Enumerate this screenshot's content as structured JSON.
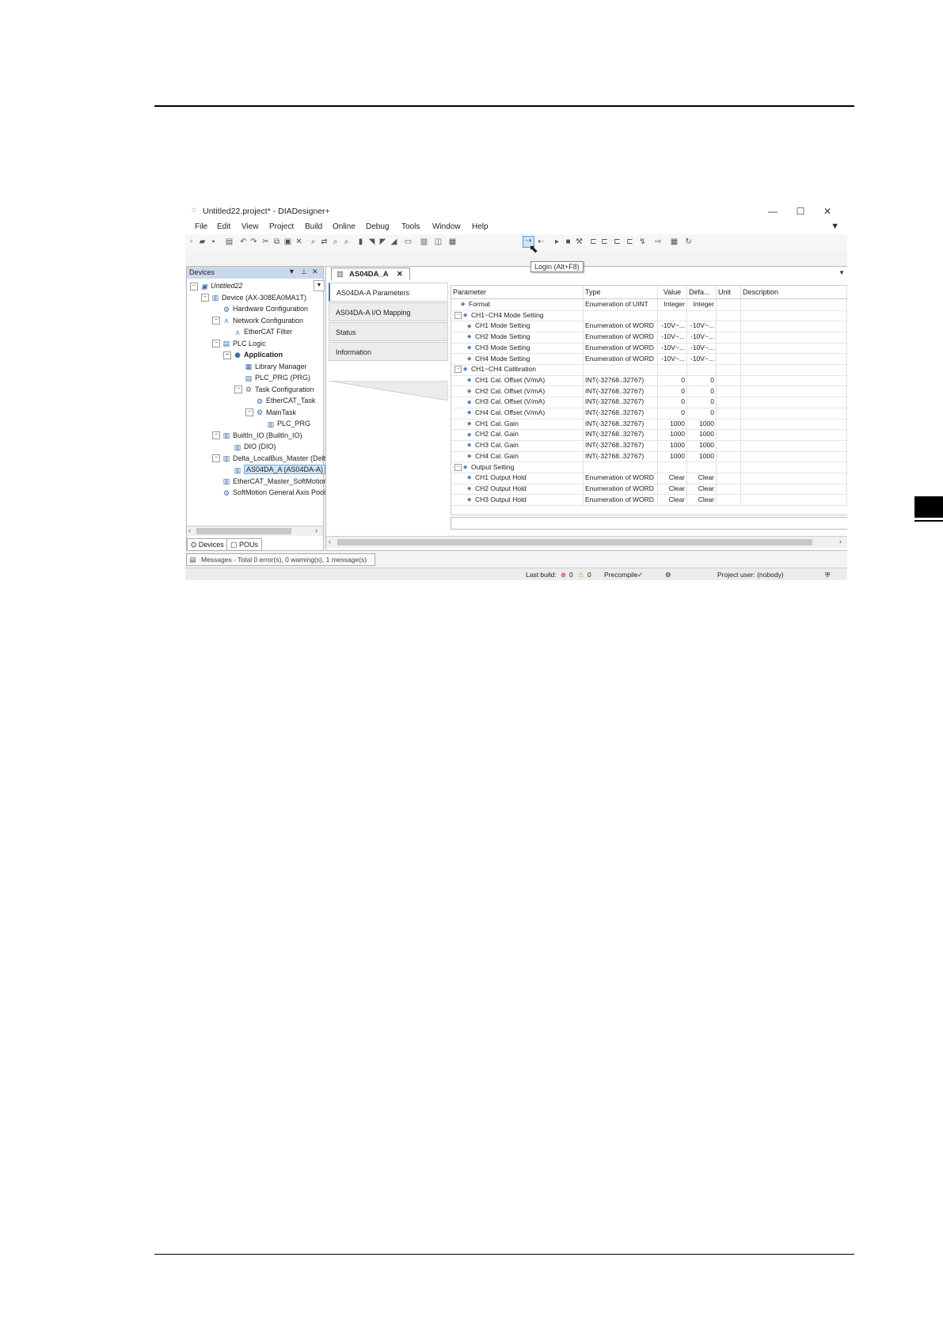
{
  "window": {
    "title": "Untitled22.project* - DIADesigner+",
    "minimize": "—",
    "maximize": "☐",
    "close": "✕"
  },
  "menu": [
    "File",
    "Edit",
    "View",
    "Project",
    "Build",
    "Online",
    "Debug",
    "Tools",
    "Window",
    "Help"
  ],
  "tooltip": "Login (Alt+F8)",
  "devices_panel": {
    "title": "Devices",
    "tree": [
      {
        "label": "Untitled22",
        "level": 0,
        "expand": "⊟",
        "icon": "project-icon",
        "glyph": "▣",
        "style": "ital"
      },
      {
        "label": "Device (AX-308EA0MA1T)",
        "level": 1,
        "expand": "⊟",
        "icon": "device-icon",
        "glyph": "▥"
      },
      {
        "label": "Hardware Configuration",
        "level": 2,
        "expand": "",
        "icon": "hardware-icon",
        "glyph": "⚙"
      },
      {
        "label": "Network Configuration",
        "level": 2,
        "expand": "⊟",
        "icon": "network-icon",
        "glyph": "⋏"
      },
      {
        "label": "EtherCAT Filter",
        "level": 3,
        "expand": "",
        "icon": "filter-icon",
        "glyph": "⋏"
      },
      {
        "label": "PLC Logic",
        "level": 2,
        "expand": "⊟",
        "icon": "plc-logic-icon",
        "glyph": "▤"
      },
      {
        "label": "Application",
        "level": 3,
        "expand": "⊟",
        "icon": "application-icon",
        "glyph": "✺",
        "style": "bold"
      },
      {
        "label": "Library Manager",
        "level": 4,
        "expand": "",
        "icon": "library-icon",
        "glyph": "▦"
      },
      {
        "label": "PLC_PRG (PRG)",
        "level": 4,
        "expand": "",
        "icon": "program-icon",
        "glyph": "▤"
      },
      {
        "label": "Task Configuration",
        "level": 4,
        "expand": "⊟",
        "icon": "task-config-icon",
        "glyph": "⚙"
      },
      {
        "label": "EtherCAT_Task",
        "level": 5,
        "expand": "",
        "icon": "task-icon",
        "glyph": "⚙"
      },
      {
        "label": "MainTask",
        "level": 5,
        "expand": "⊟",
        "icon": "task-icon",
        "glyph": "⚙"
      },
      {
        "label": "PLC_PRG",
        "level": 6,
        "expand": "",
        "icon": "program-call-icon",
        "glyph": "▥"
      },
      {
        "label": "BuiltIn_IO (BuiltIn_IO)",
        "level": 2,
        "expand": "⊟",
        "icon": "io-module-icon",
        "glyph": "▥"
      },
      {
        "label": "DIO (DIO)",
        "level": 3,
        "expand": "",
        "icon": "io-module-icon",
        "glyph": "▥"
      },
      {
        "label": "Delta_LocalBus_Master (Delta",
        "level": 2,
        "expand": "⊟",
        "icon": "bus-master-icon",
        "glyph": "▥"
      },
      {
        "label": "AS04DA_A (AS04DA-A)",
        "level": 3,
        "expand": "",
        "icon": "module-icon",
        "glyph": "▥",
        "style": "selected"
      },
      {
        "label": "EtherCAT_Master_SoftMotion",
        "level": 2,
        "expand": "",
        "icon": "ethercat-master-icon",
        "glyph": "▥"
      },
      {
        "label": "SoftMotion General Axis Pool",
        "level": 2,
        "expand": "",
        "icon": "axis-pool-icon",
        "glyph": "⚙"
      }
    ],
    "bottom_tabs": [
      "Devices",
      "POUs"
    ]
  },
  "editor": {
    "tab_title": "AS04DA_A",
    "subtabs": [
      "AS04DA-A Parameters",
      "AS04DA-A I/O Mapping",
      "Status",
      "Information"
    ],
    "columns": [
      "Parameter",
      "Type",
      "Value",
      "Defa...",
      "Unit",
      "Description"
    ],
    "rows": [
      {
        "name": "Format",
        "type": "Enumeration of UINT",
        "value": "Integer",
        "default": "Integer",
        "indent": 1,
        "group": false
      },
      {
        "name": "CH1~CH4 Mode Setting",
        "type": "",
        "value": "",
        "default": "",
        "indent": 0,
        "group": true
      },
      {
        "name": "CH1 Mode Setting",
        "type": "Enumeration of WORD",
        "value": "-10V~...",
        "default": "-10V~...",
        "indent": 2,
        "group": false
      },
      {
        "name": "CH2 Mode Setting",
        "type": "Enumeration of WORD",
        "value": "-10V~...",
        "default": "-10V~...",
        "indent": 2,
        "group": false
      },
      {
        "name": "CH3 Mode Setting",
        "type": "Enumeration of WORD",
        "value": "-10V~...",
        "default": "-10V~...",
        "indent": 2,
        "group": false
      },
      {
        "name": "CH4 Mode Setting",
        "type": "Enumeration of WORD",
        "value": "-10V~...",
        "default": "-10V~...",
        "indent": 2,
        "group": false
      },
      {
        "name": "CH1~CH4 Calibration",
        "type": "",
        "value": "",
        "default": "",
        "indent": 0,
        "group": true
      },
      {
        "name": "CH1 Cal. Offset (V/mA)",
        "type": "INT(-32768..32767)",
        "value": "0",
        "default": "0",
        "indent": 2,
        "group": false
      },
      {
        "name": "CH2 Cal. Offset (V/mA)",
        "type": "INT(-32768..32767)",
        "value": "0",
        "default": "0",
        "indent": 2,
        "group": false
      },
      {
        "name": "CH3 Cal. Offset (V/mA)",
        "type": "INT(-32768..32767)",
        "value": "0",
        "default": "0",
        "indent": 2,
        "group": false
      },
      {
        "name": "CH4 Cal. Offset (V/mA)",
        "type": "INT(-32768..32767)",
        "value": "0",
        "default": "0",
        "indent": 2,
        "group": false
      },
      {
        "name": "CH1 Cal. Gain",
        "type": "INT(-32768..32767)",
        "value": "1000",
        "default": "1000",
        "indent": 2,
        "group": false
      },
      {
        "name": "CH2 Cal. Gain",
        "type": "INT(-32768..32767)",
        "value": "1000",
        "default": "1000",
        "indent": 2,
        "group": false
      },
      {
        "name": "CH3 Cal. Gain",
        "type": "INT(-32768..32767)",
        "value": "1000",
        "default": "1000",
        "indent": 2,
        "group": false
      },
      {
        "name": "CH4 Cal. Gain",
        "type": "INT(-32768..32767)",
        "value": "1000",
        "default": "1000",
        "indent": 2,
        "group": false
      },
      {
        "name": "Output Setting",
        "type": "",
        "value": "",
        "default": "",
        "indent": 0,
        "group": true
      },
      {
        "name": "CH1 Output Hold",
        "type": "Enumeration of WORD",
        "value": "Clear",
        "default": "Clear",
        "indent": 2,
        "group": false
      },
      {
        "name": "CH2 Output Hold",
        "type": "Enumeration of WORD",
        "value": "Clear",
        "default": "Clear",
        "indent": 2,
        "group": false
      },
      {
        "name": "CH3 Output Hold",
        "type": "Enumeration of WORD",
        "value": "Clear",
        "default": "Clear",
        "indent": 2,
        "group": false
      }
    ]
  },
  "messages": "Messages - Total 0 error(s), 0 warning(s), 1 message(s)",
  "status": {
    "last_build_label": "Last build:",
    "errors": "0",
    "warnings": "0",
    "precompile_label": "Precompile",
    "project_user": "Project user: (nobody)"
  },
  "colors": {
    "accent": "#3a78c6",
    "panel_header": "#cad9ea",
    "selection": "#cce4f7"
  }
}
